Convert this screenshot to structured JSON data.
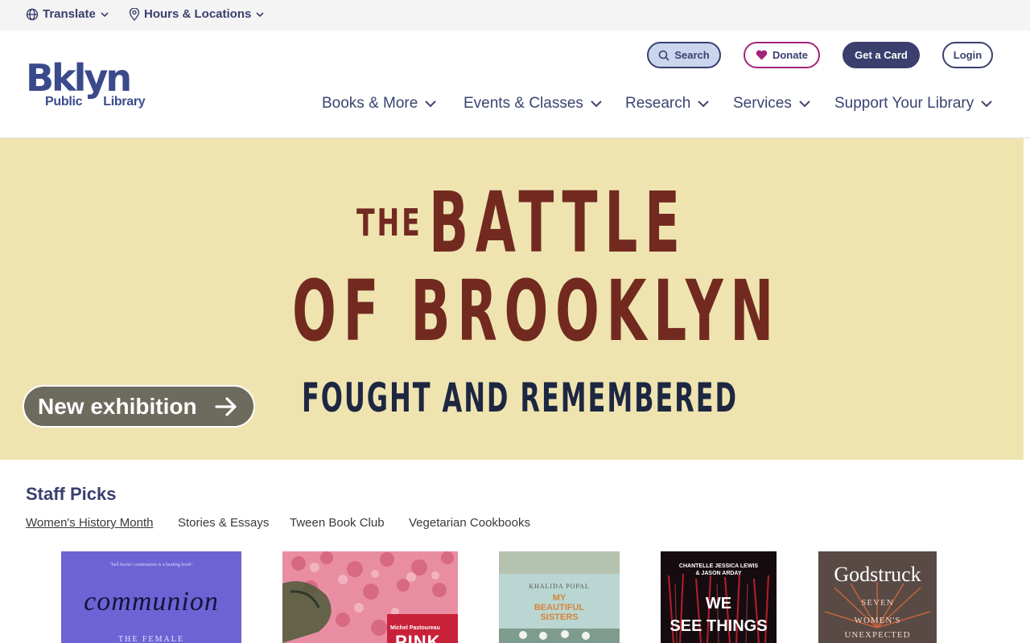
{
  "utility": {
    "translate_label": "Translate",
    "hours_label": "Hours & Locations"
  },
  "logo": {
    "main": "Bklyn",
    "sub_left": "Public",
    "sub_right": "Library"
  },
  "header_buttons": {
    "search": "Search",
    "donate": "Donate",
    "get_card": "Get a Card",
    "login": "Login"
  },
  "nav": [
    {
      "label": "Books & More"
    },
    {
      "label": "Events & Classes"
    },
    {
      "label": "Research"
    },
    {
      "label": "Services"
    },
    {
      "label": "Support Your Library"
    }
  ],
  "hero": {
    "title_prefix": "THE",
    "title_line1": "BATTLE",
    "title_line2": "OF BROOKLYN",
    "subtitle": "FOUGHT AND REMEMBERED",
    "cta": "New exhibition",
    "colors": {
      "background": "#efe4b0",
      "title": "#722a20",
      "subtitle": "#1d2742",
      "cta": "#6d6b5e"
    }
  },
  "staff_picks": {
    "title": "Staff Picks",
    "tabs": [
      {
        "label": "Women's History Month",
        "active": true
      },
      {
        "label": "Stories & Essays",
        "active": false
      },
      {
        "label": "Tween Book Club",
        "active": false
      },
      {
        "label": "Vegetarian Cookbooks",
        "active": false
      }
    ],
    "books": [
      {
        "cover_title": "communion",
        "cover_subtitle": "THE FEMALE",
        "cover_blurb": "\"bell hooks' communion is a healing book\""
      },
      {
        "cover_author": "Michel Pastoureau",
        "cover_title": "PINK"
      },
      {
        "cover_author": "KHALIDA POPAL",
        "cover_title_line1": "MY",
        "cover_title_line2": "BEAUTIFUL",
        "cover_title_line3": "SISTERS"
      },
      {
        "cover_author_line1": "CHANTELLE JESSICA LEWIS",
        "cover_author_line2": "& JASON ARDAY",
        "cover_title_line1": "WE",
        "cover_title_line2": "SEE THINGS"
      },
      {
        "cover_title": "Godstruck",
        "cover_subtitle_line1": "SEVEN",
        "cover_subtitle_line2": "WOMEN'S",
        "cover_subtitle_line3": "UNEXPECTED"
      }
    ]
  },
  "colors": {
    "brand": "#3a3f6e",
    "donate_border": "#a3257a",
    "search_fill": "#c9d6ee"
  }
}
